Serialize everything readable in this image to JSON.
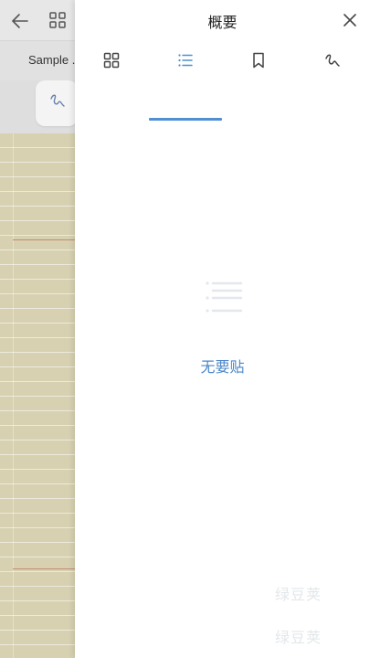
{
  "background_app": {
    "document_tab_label": "Sample .",
    "paper_color": "#d7d1b1",
    "icons": [
      "back-arrow-icon",
      "grid-view-icon",
      "pen-icon"
    ]
  },
  "drawer": {
    "title": "概要",
    "close_icon": "close-icon",
    "tabs": [
      {
        "name": "thumbnails",
        "icon": "grid-icon",
        "active": false
      },
      {
        "name": "outline",
        "icon": "list-icon",
        "active": true
      },
      {
        "name": "bookmarks",
        "icon": "bookmark-icon",
        "active": false
      },
      {
        "name": "handwriting",
        "icon": "scribble-icon",
        "active": false
      }
    ],
    "empty_state": {
      "icon": "empty-list-icon",
      "text": "无要贴"
    },
    "watermarks": [
      "绿豆荚",
      "绿豆荚"
    ],
    "accent_color": "#4f8fd2"
  }
}
